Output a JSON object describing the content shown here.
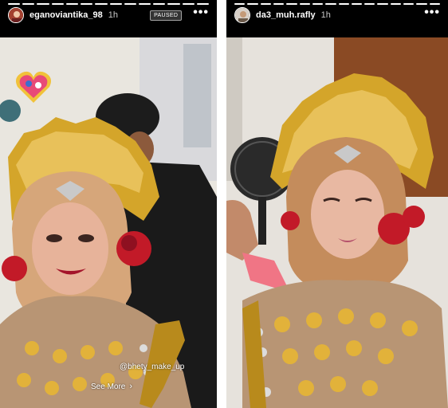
{
  "stories": [
    {
      "username": "eganoviantika_98",
      "time": "1h",
      "state": "PAUSED",
      "segments_total": 14,
      "segments_done": 14,
      "watermark": "@bhety_make_up",
      "cta": "See More",
      "cta_icon": "chevron-right-icon"
    },
    {
      "username": "da3_muh.rafly",
      "time": "1h",
      "segments_total": 16,
      "segments_done": 16
    }
  ],
  "icons": {
    "more": "more-dots-icon",
    "sticker": "heart-sticker-icon"
  },
  "more_label": "•••",
  "chevron": "›",
  "colors": {
    "background": "#000000",
    "gold": "#d4a52a",
    "hijab": "#d6a67a",
    "rose": "#c21a28"
  }
}
